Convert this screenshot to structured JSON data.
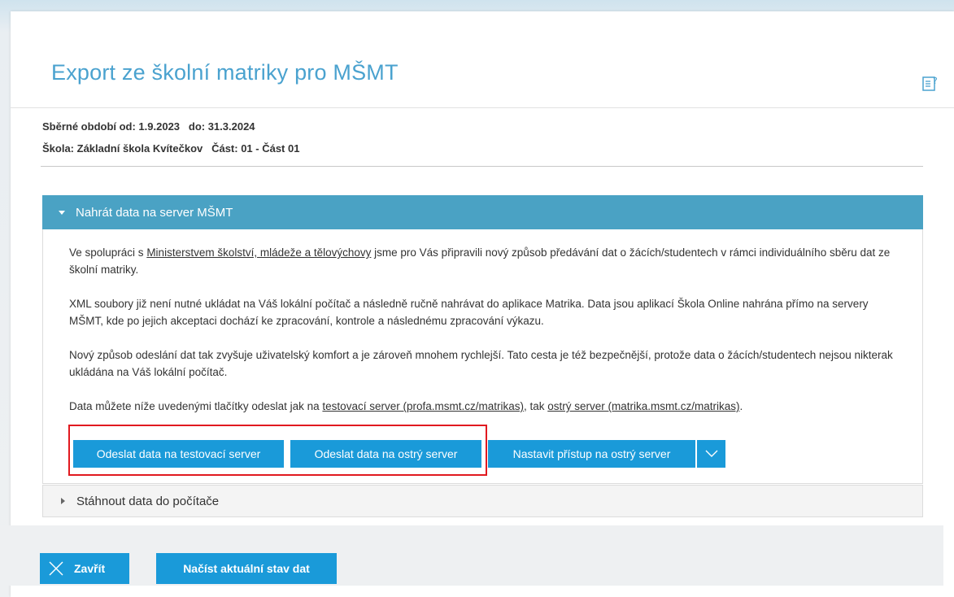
{
  "dialog": {
    "title": "Export ze školní matriky pro MŠMT",
    "help_icon": "help-document-icon"
  },
  "info": {
    "period": "Sběrné období od: 1.9.2023   do: 31.3.2024",
    "school": "Škola: Základní škola Kvítečkov   Část: 01 - Část 01"
  },
  "upload_panel": {
    "title": "Nahrát data na server MŠMT",
    "p1_before": "Ve spolupráci s ",
    "p1_link": "Ministerstvem školství, mládeže a tělovýchovy",
    "p1_after": " jsme pro Vás připravili nový způsob předávání dat o žácích/studentech v rámci individuálního sběru dat ze školní matriky.",
    "p2": "XML soubory již není nutné ukládat na Váš lokální počítač a následně ručně nahrávat do aplikace Matrika. Data jsou aplikací Škola Online nahrána přímo na servery MŠMT, kde po jejich akceptaci dochází ke zpracování, kontrole a následnému zpracování výkazu.",
    "p3": "Nový způsob odeslání dat tak zvyšuje uživatelský komfort a je zároveň mnohem rychlejší. Tato cesta je též bezpečnější, protože data o žácích/studentech nejsou nikterak ukládána na Váš lokální počítač.",
    "p4_before": "Data můžete níže uvedenými tlačítky odeslat jak na ",
    "p4_link1": "testovací server (profa.msmt.cz/matrikas)",
    "p4_mid": ", tak ",
    "p4_link2": "ostrý server (matrika.msmt.cz/matrikas)",
    "p4_after": ".",
    "btn_test": "Odeslat data na testovací server",
    "btn_prod": "Odeslat data na ostrý server",
    "btn_access": "Nastavit přístup na ostrý server"
  },
  "download_panel": {
    "title": "Stáhnout data do počítače"
  },
  "footer": {
    "close_label": "Zavřít",
    "load_label": "Načíst aktuální stav dat"
  },
  "colors": {
    "accent": "#1a9ad9",
    "title": "#4aa2cf",
    "panel_header": "#4aa2c4",
    "highlight": "#e1191f"
  }
}
